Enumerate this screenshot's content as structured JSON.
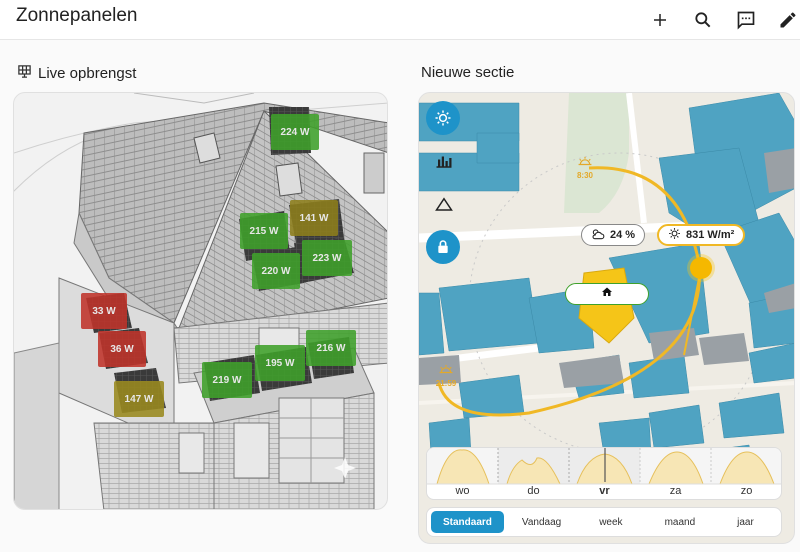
{
  "header": {
    "title": "Zonnepanelen",
    "icons": [
      "plus-icon",
      "search-icon",
      "chat-icon",
      "edit-icon"
    ]
  },
  "left_section": {
    "title": "Live opbrengst",
    "icon": "solar-panel-icon",
    "panels": [
      {
        "label": "224 W",
        "color": "#3fa12b"
      },
      {
        "label": "141 W",
        "color": "#8e7f1c"
      },
      {
        "label": "215 W",
        "color": "#3fa12b"
      },
      {
        "label": "220 W",
        "color": "#3fa12b"
      },
      {
        "label": "223 W",
        "color": "#3fa12b"
      },
      {
        "label": "33 W",
        "color": "#c0342b"
      },
      {
        "label": "36 W",
        "color": "#c0342b"
      },
      {
        "label": "147 W",
        "color": "#9a8a1f"
      },
      {
        "label": "219 W",
        "color": "#3fa12b"
      },
      {
        "label": "195 W",
        "color": "#3fa12b"
      },
      {
        "label": "216 W",
        "color": "#3fa12b"
      }
    ]
  },
  "right_section": {
    "title": "Nieuwe sectie",
    "sunrise_time": "8:30",
    "sunset_time": "21:59",
    "cloud_pill": "24 %",
    "irradiance_pill": "831 W/m²",
    "days": [
      "wo",
      "do",
      "vr",
      "za",
      "zo"
    ],
    "selected_day": "vr",
    "ranges": [
      "Standaard",
      "Vandaag",
      "week",
      "maand",
      "jaar"
    ],
    "active_range": "Standaard",
    "colors": {
      "accent": "#1e93c9",
      "sun": "#f5c518",
      "building": "#4fa3c2"
    }
  }
}
